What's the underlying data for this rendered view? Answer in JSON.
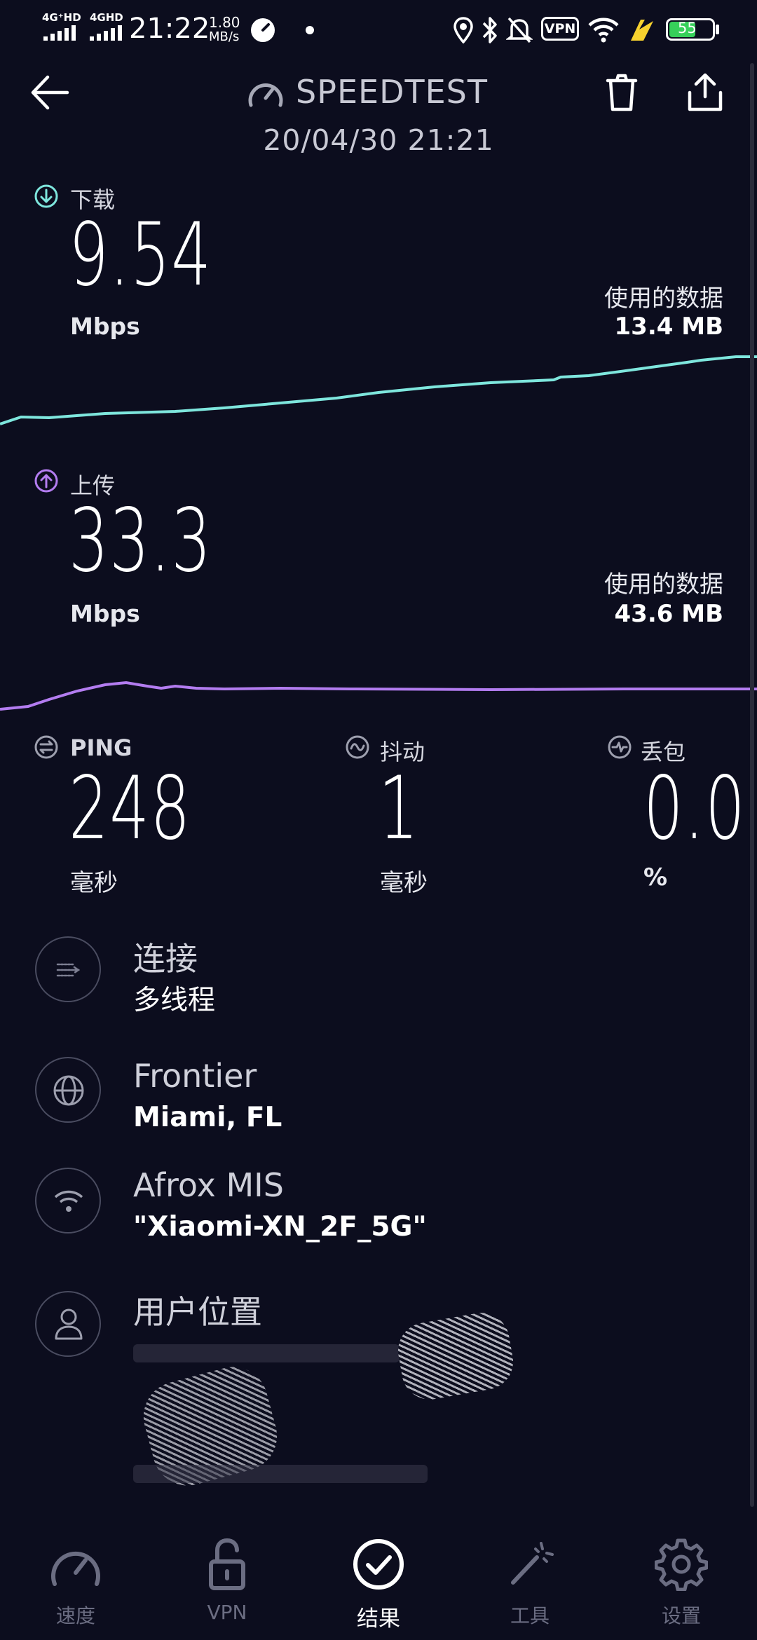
{
  "status_bar": {
    "signal1": "4G⁺HD",
    "signal2": "4GHD",
    "time": "21:22",
    "speed_value": "1.80",
    "speed_unit": "MB/s",
    "vpn": "VPN",
    "battery": "55"
  },
  "header": {
    "title": "SPEEDTEST",
    "datetime": "20/04/30 21:21"
  },
  "download": {
    "label": "下载",
    "value": "9.54",
    "unit": "Mbps",
    "used_label": "使用的数据",
    "used_value": "13.4 MB",
    "color": "#7ee6dd"
  },
  "upload": {
    "label": "上传",
    "value": "33.3",
    "unit": "Mbps",
    "used_label": "使用的数据",
    "used_value": "43.6 MB",
    "color": "#b37cf0"
  },
  "stats": {
    "ping": {
      "label": "PING",
      "value": "248",
      "unit": "毫秒"
    },
    "jitter": {
      "label": "抖动",
      "value": "1",
      "unit": "毫秒"
    },
    "loss": {
      "label": "丢包",
      "value": "0.0",
      "unit": "%"
    }
  },
  "info": {
    "connection": {
      "title": "连接",
      "sub": "多线程",
      "icon": "arrows-icon"
    },
    "server": {
      "title": "Frontier",
      "sub": "Miami, FL",
      "icon": "globe-icon"
    },
    "network": {
      "title": "Afrox MIS",
      "sub": "\"Xiaomi-XN_2F_5G\"",
      "icon": "wifi-icon"
    },
    "location": {
      "title": "用户位置",
      "icon": "user-icon"
    }
  },
  "nav": {
    "items": [
      {
        "label": "速度",
        "icon": "speedometer-icon"
      },
      {
        "label": "VPN",
        "icon": "lock-icon"
      },
      {
        "label": "结果",
        "icon": "check-circle-icon"
      },
      {
        "label": "工具",
        "icon": "wand-icon"
      },
      {
        "label": "设置",
        "icon": "gear-icon"
      }
    ],
    "active_index": 2
  }
}
